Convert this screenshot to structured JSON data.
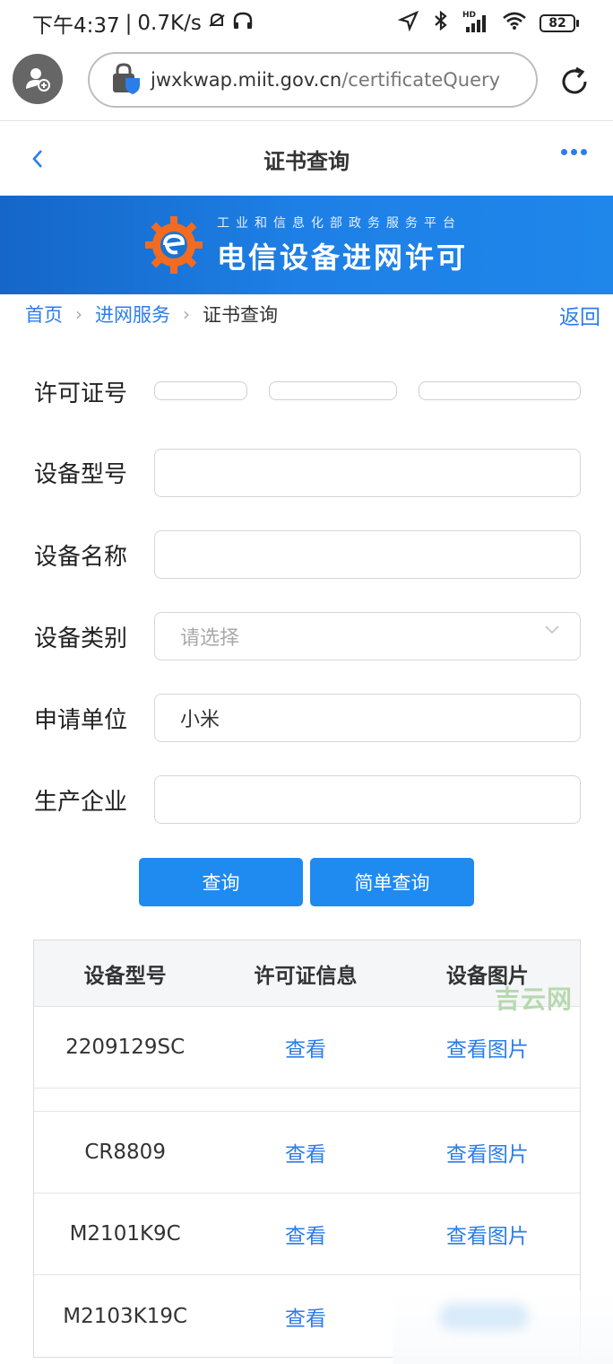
{
  "status_bar": {
    "time": "下午4:37",
    "network_speed": "0.7K/s",
    "battery": "82",
    "hd_label": "HD"
  },
  "browser": {
    "url_domain": "jwxkwap.miit.gov.cn",
    "url_path": "/certificateQuery"
  },
  "header": {
    "title": "证书查询"
  },
  "banner": {
    "subtitle": "工业和信息化部政务服务平台",
    "title": "电信设备进网许可"
  },
  "breadcrumb": {
    "home": "首页",
    "service": "进网服务",
    "current": "证书查询",
    "return": "返回"
  },
  "form": {
    "license_label": "许可证号",
    "model_label": "设备型号",
    "model_value": "",
    "name_label": "设备名称",
    "name_value": "",
    "category_label": "设备类别",
    "category_placeholder": "请选择",
    "applicant_label": "申请单位",
    "applicant_value": "小米",
    "manufacturer_label": "生产企业",
    "manufacturer_value": "",
    "query_button": "查询",
    "simple_query_button": "简单查询"
  },
  "table": {
    "headers": [
      "设备型号",
      "许可证信息",
      "设备图片"
    ],
    "rows": [
      {
        "model": "2209129SC",
        "license": "查看",
        "image": "查看图片"
      },
      {
        "model": "CR8809",
        "license": "查看",
        "image": "查看图片"
      },
      {
        "model": "M2101K9C",
        "license": "查看",
        "image": "查看图片"
      },
      {
        "model": "M2103K19C",
        "license": "查看",
        "image": ""
      }
    ]
  },
  "watermark": "吉云网",
  "colors": {
    "accent": "#2b7de9",
    "button": "#1f8af0",
    "banner": "#1e80e6"
  }
}
